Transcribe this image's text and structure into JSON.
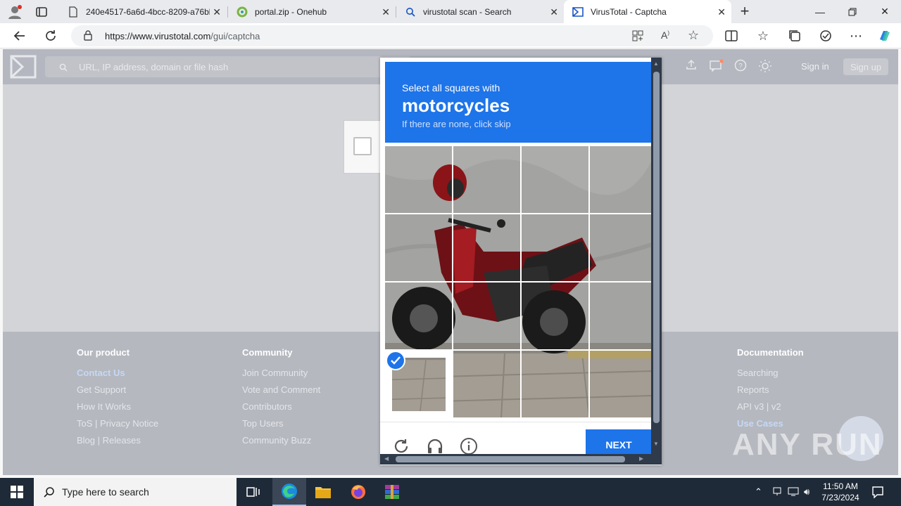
{
  "browser": {
    "tabs": [
      {
        "title": "240e4517-6a6d-4bcc-8209-a76bb",
        "active": false
      },
      {
        "title": "portal.zip - Onehub",
        "active": false
      },
      {
        "title": "virustotal scan - Search",
        "active": false
      },
      {
        "title": "VirusTotal - Captcha",
        "active": true
      }
    ],
    "url_host": "https://www.virustotal.com",
    "url_path": "/gui/captcha"
  },
  "virustotal": {
    "search_placeholder": "URL, IP address, domain or file hash",
    "sign_in": "Sign in",
    "sign_up": "Sign up"
  },
  "footer": {
    "columns": [
      {
        "heading": "Our product",
        "links": [
          "Contact Us",
          "Get Support",
          "How It Works",
          "ToS | Privacy Notice",
          "Blog | Releases"
        ]
      },
      {
        "heading": "Community",
        "links": [
          "Join Community",
          "Vote and Comment",
          "Contributors",
          "Top Users",
          "Community Buzz"
        ]
      },
      {
        "heading": "Documentation",
        "links": [
          "Searching",
          "Reports",
          "API v3 | v2",
          "Use Cases"
        ]
      }
    ]
  },
  "captcha": {
    "prompt_line1": "Select all squares with",
    "prompt_target": "motorcycles",
    "prompt_line3": "If there are none, click skip",
    "selected_cells": [
      12
    ],
    "next_label": "NEXT"
  },
  "watermark": "ANY RUN",
  "taskbar": {
    "search_placeholder": "Type here to search",
    "time": "11:50 AM",
    "date": "7/23/2024"
  },
  "colors": {
    "hcaptcha_blue": "#1e74e9",
    "taskbar": "#1f2a38",
    "vt_header": "#b4b7bf"
  }
}
